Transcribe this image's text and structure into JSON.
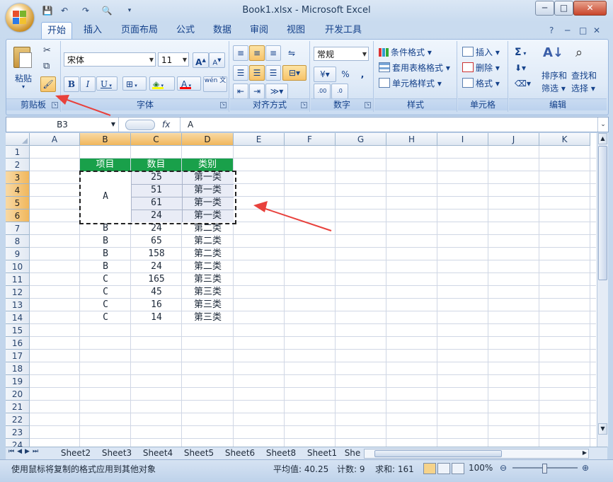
{
  "window": {
    "title": "Book1.xlsx - Microsoft Excel",
    "controls": [
      "─",
      "□",
      "✕"
    ],
    "ribbon_controls": [
      "?",
      "─",
      "□",
      "✕"
    ]
  },
  "qat": {
    "save": "💾",
    "undo": "↶",
    "redo": "↷",
    "print_preview": "🔍",
    "more": "▾"
  },
  "tabs": [
    "开始",
    "插入",
    "页面布局",
    "公式",
    "数据",
    "审阅",
    "视图",
    "开发工具"
  ],
  "ribbon": {
    "clipboard": {
      "label": "剪贴板",
      "paste": "粘贴",
      "cut_icon": "✂",
      "copy_icon": "⧉",
      "format_painter_icon": "🖌"
    },
    "font": {
      "label": "字体",
      "name": "宋体",
      "size": "11",
      "grow": "A",
      "shrink": "A",
      "bold": "B",
      "italic": "I",
      "underline": "U",
      "border": "⊞",
      "fill": "◈",
      "color": "A",
      "phonetic": "wén 文"
    },
    "alignment": {
      "label": "对齐方式"
    },
    "number": {
      "label": "数字",
      "format": "常规",
      "percent": "%",
      "comma": ",",
      "inc_dec": ".00",
      "dec_dec": ".0"
    },
    "styles": {
      "label": "样式",
      "conditional": "条件格式",
      "table": "套用表格格式",
      "cell": "单元格样式"
    },
    "cells": {
      "label": "单元格",
      "insert": "插入",
      "delete": "删除",
      "format": "格式"
    },
    "editing": {
      "label": "编辑",
      "sum": "Σ",
      "sort": "排序和",
      "sort2": "筛选",
      "find": "查找和",
      "find2": "选择"
    }
  },
  "formula_bar": {
    "name_box": "B3",
    "fx": "fx",
    "content": "A"
  },
  "columns": [
    "A",
    "B",
    "C",
    "D",
    "E",
    "F",
    "G",
    "H",
    "I",
    "J",
    "K"
  ],
  "rows": [
    "1",
    "2",
    "3",
    "4",
    "5",
    "6",
    "7",
    "8",
    "9",
    "10",
    "11",
    "12",
    "13",
    "14",
    "15",
    "16",
    "17",
    "18",
    "19",
    "20",
    "21",
    "22",
    "23",
    "24"
  ],
  "table": {
    "headers": [
      "项目",
      "数目",
      "类别"
    ],
    "merged_item": "A",
    "data": [
      [
        "",
        "25",
        "第一类"
      ],
      [
        "",
        "51",
        "第一类"
      ],
      [
        "",
        "61",
        "第一类"
      ],
      [
        "",
        "24",
        "第一类"
      ],
      [
        "B",
        "24",
        "第二类"
      ],
      [
        "B",
        "65",
        "第二类"
      ],
      [
        "B",
        "158",
        "第二类"
      ],
      [
        "B",
        "24",
        "第二类"
      ],
      [
        "C",
        "165",
        "第三类"
      ],
      [
        "C",
        "45",
        "第三类"
      ],
      [
        "C",
        "16",
        "第三类"
      ],
      [
        "C",
        "14",
        "第三类"
      ]
    ]
  },
  "sheets": [
    "Sheet2",
    "Sheet3",
    "Sheet4",
    "Sheet5",
    "Sheet6",
    "Sheet8",
    "Sheet1",
    "She"
  ],
  "status": {
    "message": "使用鼠标将复制的格式应用到其他对象",
    "average": "平均值: 40.25",
    "count": "计数: 9",
    "sum": "求和: 161",
    "zoom": "100%"
  },
  "colors": {
    "header_green": "#19a04a",
    "arrow_red": "#e8413c",
    "selected_header": "#f1b75c"
  }
}
